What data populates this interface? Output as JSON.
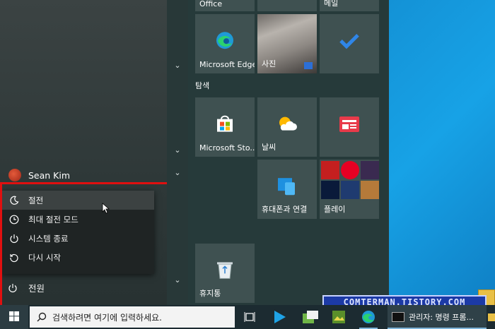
{
  "tiles": {
    "office": "Office",
    "mail": "메일",
    "edge": "Microsoft Edge",
    "photos": "사진",
    "todo": "",
    "explore_group": "탐색",
    "store": "Microsoft Sto...",
    "weather": "날씨",
    "news": "",
    "phone": "휴대폰과 연결",
    "play": "플레이",
    "recycle": "휴지통"
  },
  "user": {
    "name": "Sean Kim"
  },
  "power_menu": {
    "items": [
      {
        "label": "절전",
        "icon": "moon-icon"
      },
      {
        "label": "최대 절전 모드",
        "icon": "clock-icon"
      },
      {
        "label": "시스템 종료",
        "icon": "power-icon"
      },
      {
        "label": "다시 시작",
        "icon": "restart-icon"
      }
    ],
    "power_label": "전원"
  },
  "taskbar": {
    "search_placeholder": "검색하려면 여기에 입력하세요.",
    "active_window": "관리자: 명령 프롬..."
  },
  "watermark": "COMTERMAN.TISTORY.COM",
  "colors": {
    "accent": "#1a8fd6",
    "highlight": "#e01010"
  }
}
